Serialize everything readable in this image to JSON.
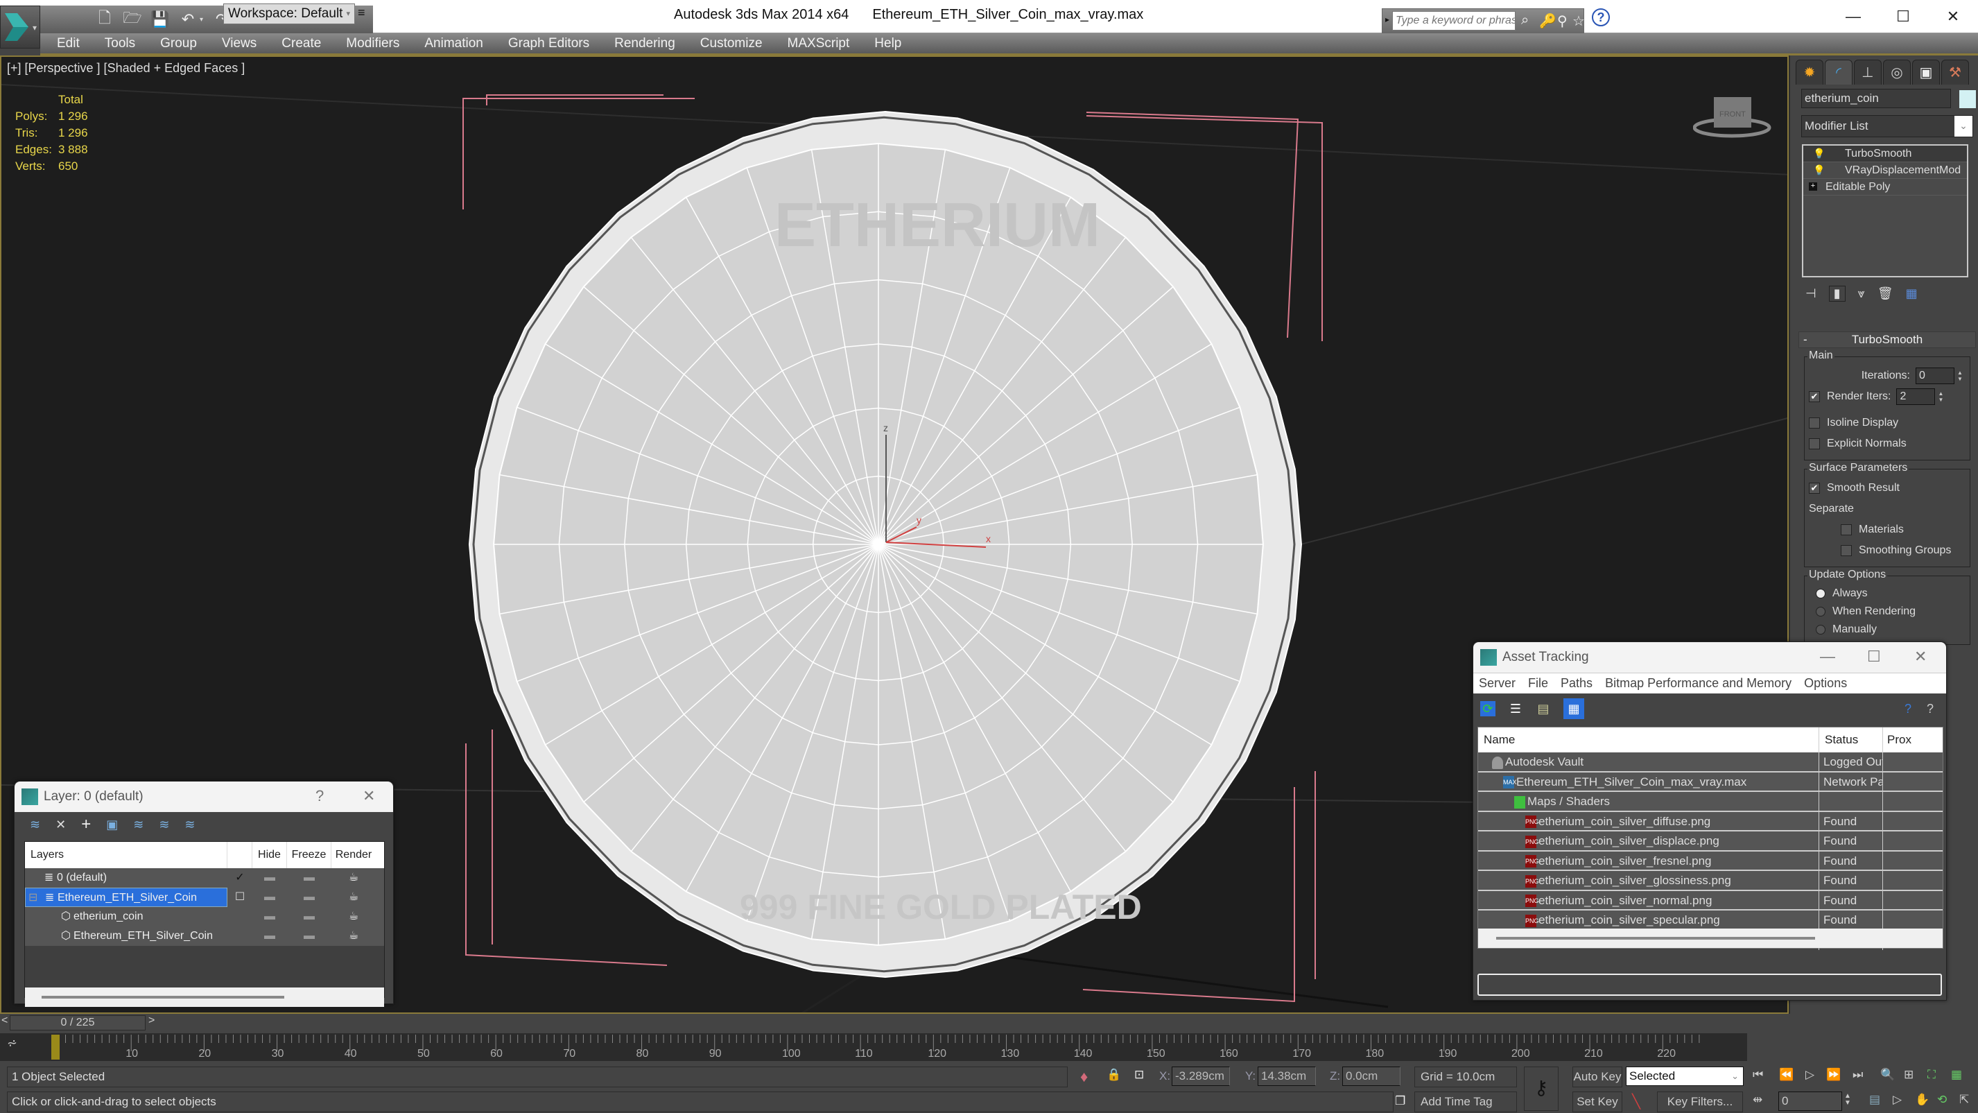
{
  "titlebar": {
    "app_name": "Autodesk 3ds Max  2014 x64",
    "file_name": "Ethereum_ETH_Silver_Coin_max_vray.max",
    "workspace": "Workspace: Default",
    "search_placeholder": "Type a keyword or phrase",
    "minimize": "—",
    "maximize": "☐",
    "close": "✕"
  },
  "menu": [
    "Edit",
    "Tools",
    "Group",
    "Views",
    "Create",
    "Modifiers",
    "Animation",
    "Graph Editors",
    "Rendering",
    "Customize",
    "MAXScript",
    "Help"
  ],
  "viewport": {
    "label": "[+] [Perspective ] [Shaded + Edged Faces ]",
    "stats_header": "Total",
    "stats": [
      {
        "label": "Polys:",
        "value": "1 296"
      },
      {
        "label": "Tris:",
        "value": "1 296"
      },
      {
        "label": "Edges:",
        "value": "3 888"
      },
      {
        "label": "Verts:",
        "value": "650"
      }
    ],
    "viewcube_label": "FRONT",
    "axis_labels": {
      "x": "x",
      "y": "y",
      "z": "z"
    },
    "coin_text_top": "ETHERIUM",
    "coin_text_bottom": "999 FINE GOLD PLATED"
  },
  "command_panel": {
    "tabs": [
      "create",
      "modify",
      "hierarchy",
      "motion",
      "display",
      "utilities"
    ],
    "object_name": "etherium_coin",
    "object_color": "#d3f1f3",
    "modifier_list_label": "Modifier List",
    "stack": [
      {
        "name": "TurboSmooth",
        "type": "modifier"
      },
      {
        "name": "VRayDisplacementMod",
        "type": "modifier"
      },
      {
        "name": "Editable Poly",
        "type": "base"
      }
    ],
    "turbosmooth": {
      "title": "TurboSmooth",
      "collapse": "-",
      "main_group": "Main",
      "iterations_label": "Iterations:",
      "iterations_value": "0",
      "render_iters_label": "Render Iters:",
      "render_iters_value": "2",
      "render_iters_checked": true,
      "isoline_label": "Isoline Display",
      "isoline_checked": false,
      "explicit_normals_label": "Explicit Normals",
      "explicit_normals_checked": false,
      "surface_group": "Surface Parameters",
      "smooth_result_label": "Smooth Result",
      "smooth_result_checked": true,
      "separate_label": "Separate",
      "materials_label": "Materials",
      "smoothing_groups_label": "Smoothing Groups",
      "update_group": "Update Options",
      "update_options": [
        "Always",
        "When Rendering",
        "Manually"
      ],
      "update_selected": "Always"
    }
  },
  "layer_dialog": {
    "title": "Layer: 0 (default)",
    "help": "?",
    "close": "✕",
    "columns": [
      "Layers",
      "",
      "Hide",
      "Freeze",
      "Render"
    ],
    "rows": [
      {
        "name": "0 (default)",
        "indent": 1,
        "current": true,
        "selected": false,
        "type": "layer"
      },
      {
        "name": "Ethereum_ETH_Silver_Coin",
        "indent": 1,
        "current": false,
        "selected": true,
        "type": "layer",
        "expander": "⊟"
      },
      {
        "name": "etherium_coin",
        "indent": 2,
        "current": false,
        "selected": false,
        "type": "object"
      },
      {
        "name": "Ethereum_ETH_Silver_Coin",
        "indent": 2,
        "current": false,
        "selected": false,
        "type": "object"
      }
    ]
  },
  "asset_dialog": {
    "title": "Asset Tracking",
    "menu": [
      "Server",
      "File",
      "Paths",
      "Bitmap Performance and Memory",
      "Options"
    ],
    "columns": [
      "Name",
      "Status",
      "Prox"
    ],
    "rows": [
      {
        "name": "Autodesk Vault",
        "status": "Logged Out ...",
        "icon": "vault",
        "indent": 1
      },
      {
        "name": "Ethereum_ETH_Silver_Coin_max_vray.max",
        "status": "Network Path",
        "icon": "max",
        "indent": 2
      },
      {
        "name": "Maps / Shaders",
        "status": "",
        "icon": "maps",
        "indent": 3
      },
      {
        "name": "etherium_coin_silver_diffuse.png",
        "status": "Found",
        "icon": "png",
        "indent": 4
      },
      {
        "name": "etherium_coin_silver_displace.png",
        "status": "Found",
        "icon": "png",
        "indent": 4
      },
      {
        "name": "etherium_coin_silver_fresnel.png",
        "status": "Found",
        "icon": "png",
        "indent": 4
      },
      {
        "name": "etherium_coin_silver_glossiness.png",
        "status": "Found",
        "icon": "png",
        "indent": 4
      },
      {
        "name": "etherium_coin_silver_normal.png",
        "status": "Found",
        "icon": "png",
        "indent": 4
      },
      {
        "name": "etherium_coin_silver_specular.png",
        "status": "Found",
        "icon": "png",
        "indent": 4
      }
    ]
  },
  "timeline": {
    "frame_display": "0 / 225",
    "current_frame": 0,
    "total_frames": 225,
    "tick_labels": [
      "0",
      "10",
      "20",
      "30",
      "40",
      "50",
      "60",
      "70",
      "80",
      "90",
      "100",
      "110",
      "120",
      "130",
      "140",
      "150",
      "160",
      "170",
      "180",
      "190",
      "200",
      "210",
      "220"
    ]
  },
  "status": {
    "selection": "1 Object Selected",
    "prompt": "Click or click-and-drag to select objects",
    "x_label": "X:",
    "x_value": "-3.289cm",
    "y_label": "Y:",
    "y_value": "14.38cm",
    "z_label": "Z:",
    "z_value": "0.0cm",
    "grid": "Grid = 10.0cm",
    "add_time_tag": "Add Time Tag",
    "auto_key": "Auto Key",
    "set_key": "Set Key",
    "key_mode": "Selected",
    "key_filters": "Key Filters...",
    "frame_value": "0"
  },
  "colors": {
    "viewport_bg": "#1d1d1d",
    "stats_text": "#e8d64a",
    "selection_blue": "#2a6fdb",
    "viewport_border": "#8a7a3a"
  }
}
